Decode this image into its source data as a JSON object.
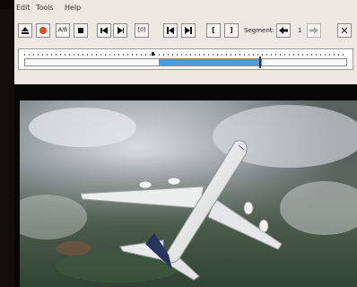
{
  "menu": [
    "Edit",
    "Tools",
    "Help"
  ],
  "toolbar": {
    "eject_icon": "eject-icon",
    "record_color": "#e24a1f",
    "ab_label": "A/B",
    "frame_label": "[0]",
    "mark_in_label": "[",
    "mark_out_label": "]",
    "segment_label": "Segment:",
    "segment_value": "1",
    "close_label": "✕"
  },
  "timeline": {
    "selection_start": 0.415,
    "selection_end": 0.735,
    "selection_color": "#5a97d6"
  },
  "video": {
    "subject": "airliner-in-flight-above-clouds"
  }
}
